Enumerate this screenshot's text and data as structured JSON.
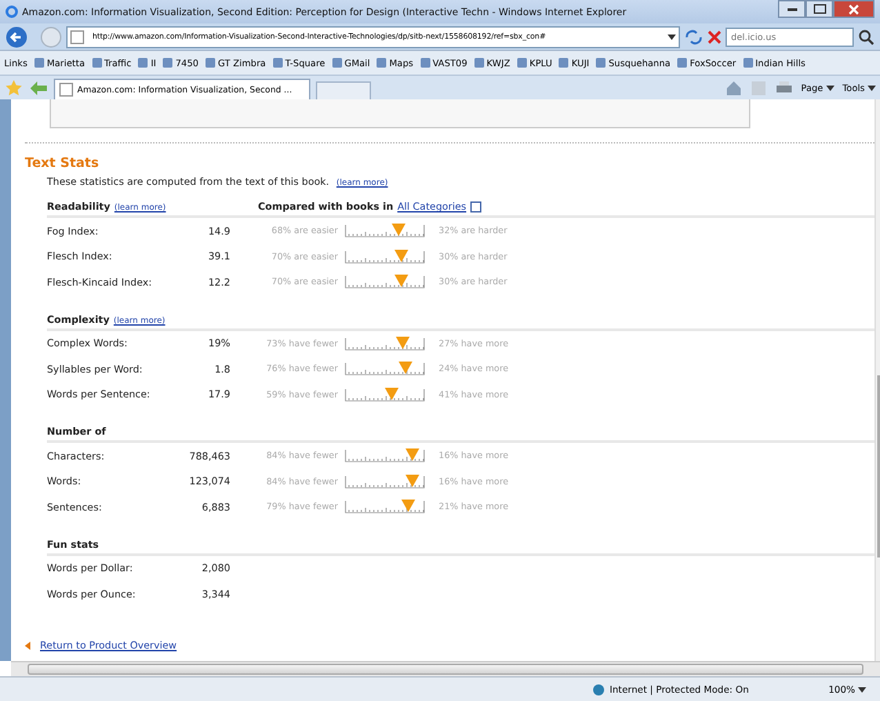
{
  "window": {
    "title": "Amazon.com: Information Visualization, Second Edition: Perception for Design (Interactive Techn - Windows Internet Explorer"
  },
  "address_bar": {
    "url": "http://www.amazon.com/Information-Visualization-Second-Interactive-Technologies/dp/sitb-next/1558608192/ref=sbx_con#",
    "search_placeholder": "del.icio.us"
  },
  "links_bar": {
    "label": "Links",
    "items": [
      "Marietta",
      "Traffic",
      "II",
      "7450",
      "GT Zimbra",
      "T-Square",
      "GMail",
      "Maps",
      "VAST09",
      "KWJZ",
      "KPLU",
      "KUJI",
      "Susquehanna",
      "FoxSoccer",
      "Indian Hills"
    ]
  },
  "tabs": [
    {
      "label": "Amazon.com: Information Visualization, Second ...",
      "selected": true
    }
  ],
  "command_bar": [
    "Page",
    "Tools"
  ],
  "page": {
    "title": "Text Stats",
    "intro": "These statistics are computed from the text of this book.",
    "intro_link": "(learn more)",
    "sections": [
      {
        "title": "Readability",
        "link": "(learn more)",
        "compare_label": "Compared with books in",
        "compare_link": "All Categories",
        "rows": [
          {
            "label": "Fog Index:",
            "value": "14.9",
            "left": "68% are easier",
            "right": "32% are harder",
            "level": 0.68
          },
          {
            "label": "Flesch Index:",
            "value": "39.1",
            "left": "70% are easier",
            "right": "30% are harder",
            "level": 0.7
          },
          {
            "label": "Flesch-Kincaid Index:",
            "value": "12.2",
            "left": "70% are easier",
            "right": "30% are harder",
            "level": 0.7
          }
        ]
      },
      {
        "title": "Complexity",
        "link": "(learn more)",
        "rows": [
          {
            "label": "Complex Words:",
            "value": "19%",
            "left": "73% have fewer",
            "right": "27% have more",
            "level": 0.73
          },
          {
            "label": "Syllables per Word:",
            "value": "1.8",
            "left": "76% have fewer",
            "right": "24% have more",
            "level": 0.76
          },
          {
            "label": "Words per Sentence:",
            "value": "17.9",
            "left": "59% have fewer",
            "right": "41% have more",
            "level": 0.59
          }
        ]
      },
      {
        "title": "Number of",
        "rows": [
          {
            "label": "Characters:",
            "value": "788,463",
            "left": "84% have fewer",
            "right": "16% have more",
            "level": 0.84
          },
          {
            "label": "Words:",
            "value": "123,074",
            "left": "84% have fewer",
            "right": "16% have more",
            "level": 0.84
          },
          {
            "label": "Sentences:",
            "value": "6,883",
            "left": "79% have fewer",
            "right": "21% have more",
            "level": 0.79
          }
        ]
      },
      {
        "title": "Fun stats",
        "rows": [
          {
            "label": "Words per Dollar:",
            "value": "2,080"
          },
          {
            "label": "Words per Ounce:",
            "value": "3,344"
          }
        ]
      }
    ],
    "back_link": "Return to Product Overview"
  },
  "status_bar": {
    "zone": "Internet | Protected Mode: On",
    "zoom": "100%"
  }
}
